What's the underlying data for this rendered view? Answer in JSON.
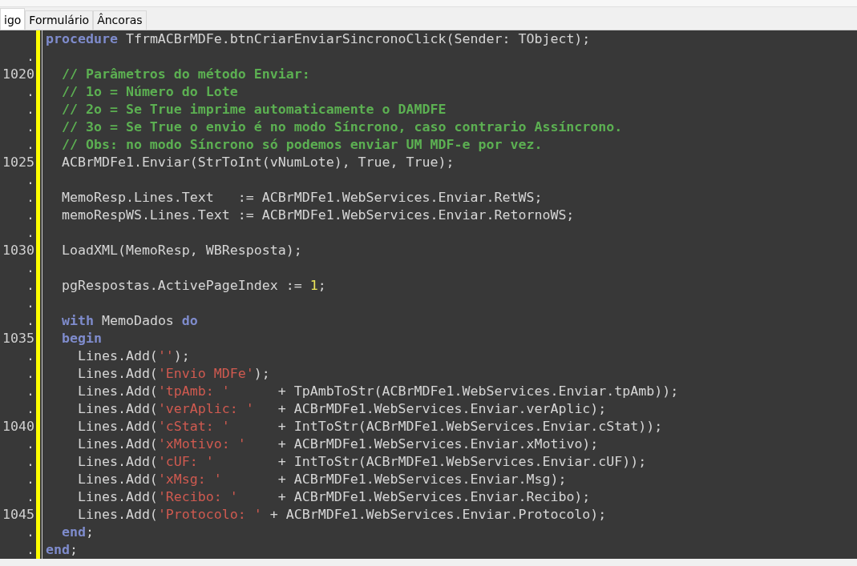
{
  "tabs": [
    {
      "label": "igo",
      "selected": true
    },
    {
      "label": "Formulário",
      "selected": false
    },
    {
      "label": "Âncoras",
      "selected": false
    }
  ],
  "editor": {
    "lines": [
      {
        "tokens": [
          {
            "kind": "keyword",
            "text": "procedure"
          },
          {
            "kind": "plain",
            "text": " TfrmACBrMDFe.btnCriarEnviarSincronoClick(Sender: TObject);"
          }
        ]
      },
      {
        "gutter": "."
      },
      {
        "gutter": "1020",
        "tokens": [
          {
            "kind": "comment",
            "text": "  // Parâmetros do método Enviar:"
          }
        ]
      },
      {
        "gutter": ".",
        "tokens": [
          {
            "kind": "comment",
            "text": "  // 1o = Número do Lote"
          }
        ]
      },
      {
        "gutter": ".",
        "tokens": [
          {
            "kind": "comment",
            "text": "  // 2o = Se True imprime automaticamente o DAMDFE"
          }
        ]
      },
      {
        "gutter": ".",
        "tokens": [
          {
            "kind": "comment",
            "text": "  // 3o = Se True o envio é no modo Síncrono, caso contrario Assíncrono."
          }
        ]
      },
      {
        "gutter": ".",
        "tokens": [
          {
            "kind": "comment",
            "text": "  // Obs: no modo Síncrono só podemos enviar UM MDF-e por vez."
          }
        ]
      },
      {
        "gutter": "1025",
        "tokens": [
          {
            "kind": "plain",
            "text": "  ACBrMDFe1.Enviar(StrToInt(vNumLote), True, True);"
          }
        ]
      },
      {
        "gutter": "."
      },
      {
        "gutter": ".",
        "tokens": [
          {
            "kind": "plain",
            "text": "  MemoResp.Lines.Text   := ACBrMDFe1.WebServices.Enviar.RetWS;"
          }
        ]
      },
      {
        "gutter": ".",
        "tokens": [
          {
            "kind": "plain",
            "text": "  memoRespWS.Lines.Text := ACBrMDFe1.WebServices.Enviar.RetornoWS;"
          }
        ]
      },
      {
        "gutter": "."
      },
      {
        "gutter": "1030",
        "tokens": [
          {
            "kind": "plain",
            "text": "  LoadXML(MemoResp, WBResposta);"
          }
        ]
      },
      {
        "gutter": "."
      },
      {
        "gutter": ".",
        "tokens": [
          {
            "kind": "plain",
            "text": "  pgRespostas.ActivePageIndex := "
          },
          {
            "kind": "number",
            "text": "1"
          },
          {
            "kind": "plain",
            "text": ";"
          }
        ]
      },
      {
        "gutter": "."
      },
      {
        "gutter": ".",
        "tokens": [
          {
            "kind": "keyword",
            "text": "  with"
          },
          {
            "kind": "plain",
            "text": " MemoDados "
          },
          {
            "kind": "keyword",
            "text": "do"
          }
        ]
      },
      {
        "gutter": "1035",
        "tokens": [
          {
            "kind": "keyword",
            "text": "  begin"
          }
        ]
      },
      {
        "gutter": ".",
        "tokens": [
          {
            "kind": "plain",
            "text": "    Lines.Add("
          },
          {
            "kind": "string",
            "text": "''"
          },
          {
            "kind": "plain",
            "text": ");"
          }
        ]
      },
      {
        "gutter": ".",
        "tokens": [
          {
            "kind": "plain",
            "text": "    Lines.Add("
          },
          {
            "kind": "string",
            "text": "'Envio MDFe'"
          },
          {
            "kind": "plain",
            "text": ");"
          }
        ]
      },
      {
        "gutter": ".",
        "tokens": [
          {
            "kind": "plain",
            "text": "    Lines.Add("
          },
          {
            "kind": "string",
            "text": "'tpAmb: '"
          },
          {
            "kind": "plain",
            "text": "      + TpAmbToStr(ACBrMDFe1.WebServices.Enviar.tpAmb));"
          }
        ]
      },
      {
        "gutter": ".",
        "tokens": [
          {
            "kind": "plain",
            "text": "    Lines.Add("
          },
          {
            "kind": "string",
            "text": "'verAplic: '"
          },
          {
            "kind": "plain",
            "text": "   + ACBrMDFe1.WebServices.Enviar.verAplic);"
          }
        ]
      },
      {
        "gutter": "1040",
        "tokens": [
          {
            "kind": "plain",
            "text": "    Lines.Add("
          },
          {
            "kind": "string",
            "text": "'cStat: '"
          },
          {
            "kind": "plain",
            "text": "      + IntToStr(ACBrMDFe1.WebServices.Enviar.cStat));"
          }
        ]
      },
      {
        "gutter": ".",
        "tokens": [
          {
            "kind": "plain",
            "text": "    Lines.Add("
          },
          {
            "kind": "string",
            "text": "'xMotivo: '"
          },
          {
            "kind": "plain",
            "text": "    + ACBrMDFe1.WebServices.Enviar.xMotivo);"
          }
        ]
      },
      {
        "gutter": ".",
        "tokens": [
          {
            "kind": "plain",
            "text": "    Lines.Add("
          },
          {
            "kind": "string",
            "text": "'cUF: '"
          },
          {
            "kind": "plain",
            "text": "        + IntToStr(ACBrMDFe1.WebServices.Enviar.cUF));"
          }
        ]
      },
      {
        "gutter": ".",
        "tokens": [
          {
            "kind": "plain",
            "text": "    Lines.Add("
          },
          {
            "kind": "string",
            "text": "'xMsg: '"
          },
          {
            "kind": "plain",
            "text": "       + ACBrMDFe1.WebServices.Enviar.Msg);"
          }
        ]
      },
      {
        "gutter": ".",
        "tokens": [
          {
            "kind": "plain",
            "text": "    Lines.Add("
          },
          {
            "kind": "string",
            "text": "'Recibo: '"
          },
          {
            "kind": "plain",
            "text": "     + ACBrMDFe1.WebServices.Enviar.Recibo);"
          }
        ]
      },
      {
        "gutter": "1045",
        "tokens": [
          {
            "kind": "plain",
            "text": "    Lines.Add("
          },
          {
            "kind": "string",
            "text": "'Protocolo: '"
          },
          {
            "kind": "plain",
            "text": " + ACBrMDFe1.WebServices.Enviar.Protocolo);"
          }
        ]
      },
      {
        "gutter": ".",
        "tokens": [
          {
            "kind": "keyword",
            "text": "  end"
          },
          {
            "kind": "plain",
            "text": ";"
          }
        ]
      },
      {
        "gutter": ".",
        "tokens": [
          {
            "kind": "keyword",
            "text": "end"
          },
          {
            "kind": "plain",
            "text": ";"
          }
        ]
      }
    ]
  }
}
